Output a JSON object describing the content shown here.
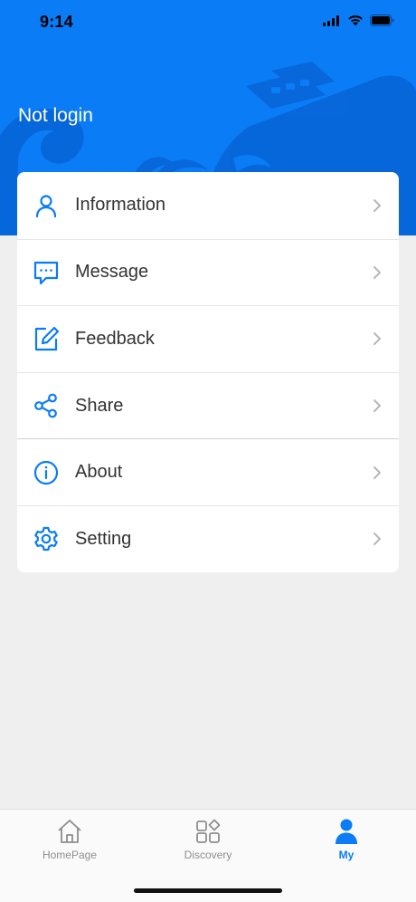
{
  "status_bar": {
    "time": "9:14"
  },
  "header": {
    "title": "Not login",
    "accent_color": "#0a7cf6"
  },
  "menu": {
    "items": [
      {
        "label": "Information",
        "icon": "person-icon"
      },
      {
        "label": "Message",
        "icon": "message-icon"
      },
      {
        "label": "Feedback",
        "icon": "edit-icon"
      },
      {
        "label": "Share",
        "icon": "share-icon"
      },
      {
        "label": "About",
        "icon": "info-icon"
      },
      {
        "label": "Setting",
        "icon": "gear-icon"
      }
    ]
  },
  "tabbar": {
    "tabs": [
      {
        "label": "HomePage",
        "icon": "home-icon",
        "active": false
      },
      {
        "label": "Discovery",
        "icon": "grid-icon",
        "active": false
      },
      {
        "label": "My",
        "icon": "person-filled-icon",
        "active": true
      }
    ],
    "active_color": "#0a7cf6",
    "inactive_color": "#8e8e8e"
  }
}
